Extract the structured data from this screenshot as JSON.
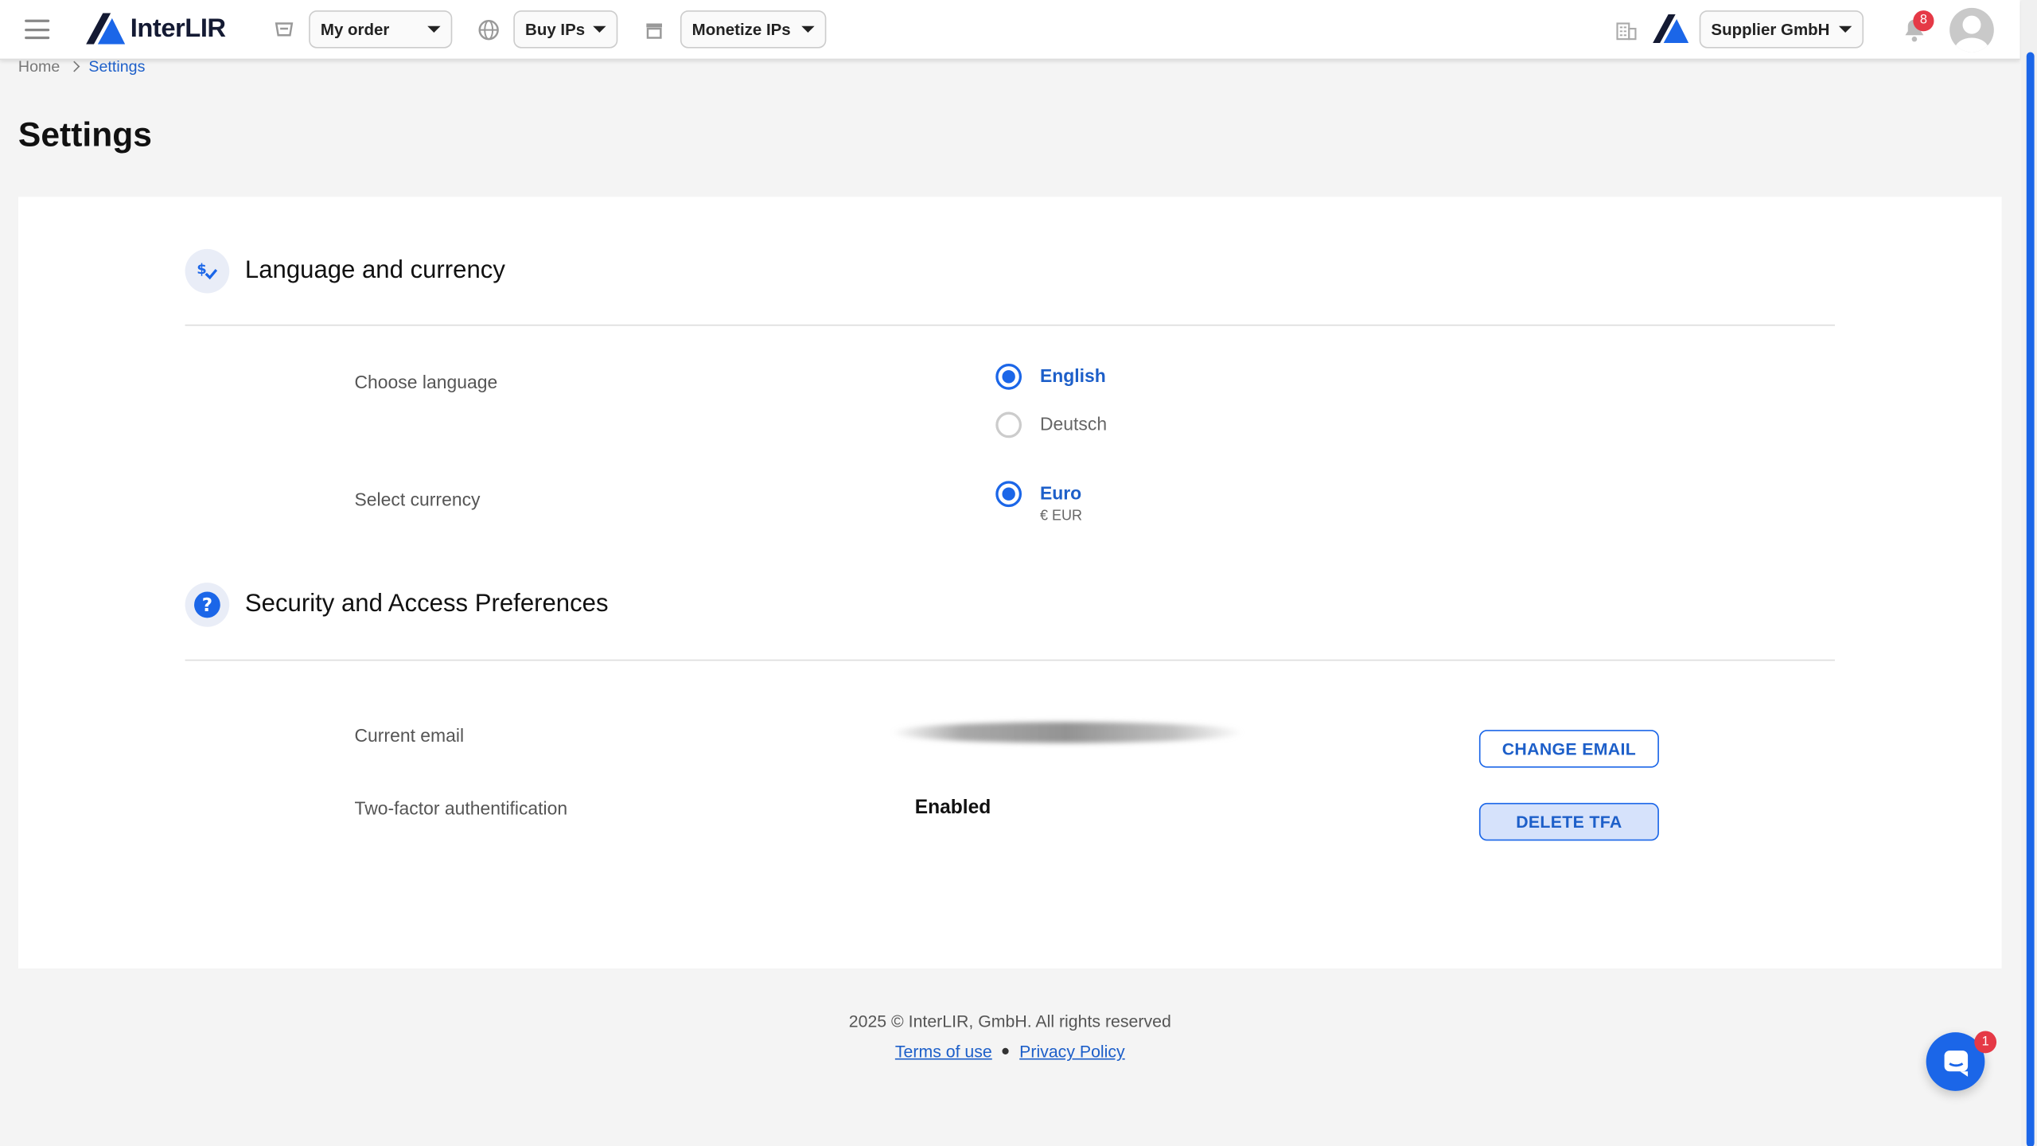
{
  "header": {
    "brand": "InterLIR",
    "order_menu": "My order",
    "buy_menu": "Buy IPs",
    "monetize_menu": "Monetize IPs",
    "company_menu": "Supplier GmbH",
    "notification_count": "8"
  },
  "breadcrumb": {
    "home": "Home",
    "current": "Settings"
  },
  "page": {
    "title": "Settings"
  },
  "language_section": {
    "title": "Language and currency",
    "choose_language_label": "Choose language",
    "languages": [
      {
        "label": "English",
        "selected": true
      },
      {
        "label": "Deutsch",
        "selected": false
      }
    ],
    "select_currency_label": "Select currency",
    "currency": {
      "label": "Euro",
      "code": "€ EUR",
      "selected": true
    }
  },
  "security_section": {
    "title": "Security and Access Preferences",
    "current_email_label": "Current email",
    "change_email_button": "CHANGE EMAIL",
    "tfa_label": "Two-factor authentification",
    "tfa_status": "Enabled",
    "delete_tfa_button": "DELETE TFA"
  },
  "footer": {
    "copyright": "2025 © InterLIR, GmbH. All rights reserved",
    "terms": "Terms of use",
    "privacy": "Privacy Policy"
  },
  "chat": {
    "badge": "1"
  },
  "colors": {
    "accent": "#1b66e8",
    "badge": "#e53946",
    "brand_dark": "#141a33"
  }
}
